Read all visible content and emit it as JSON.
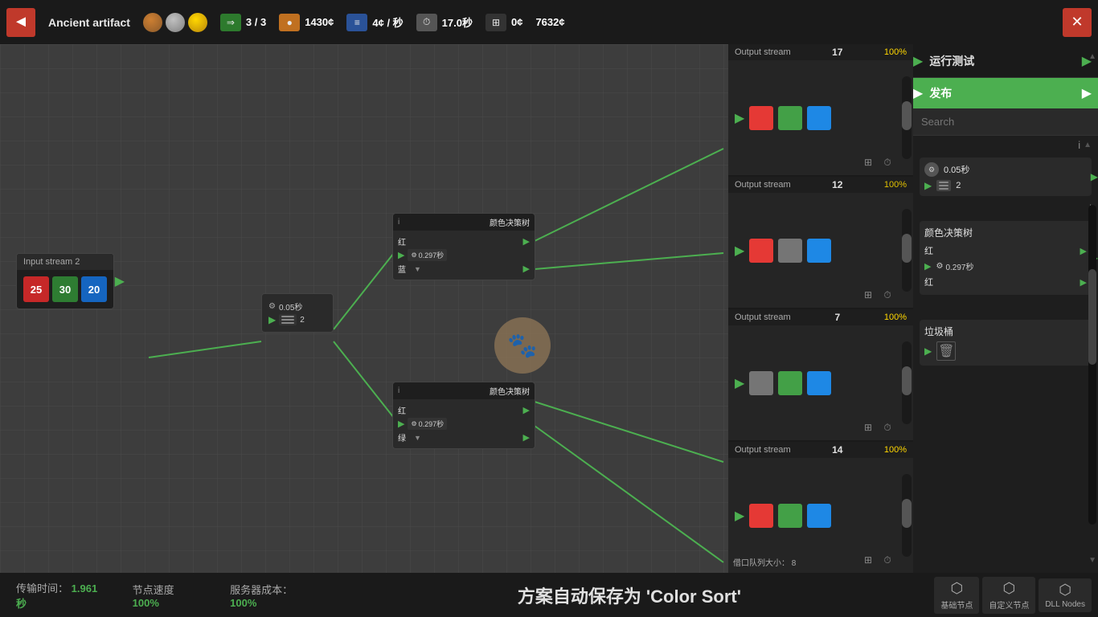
{
  "topbar": {
    "back_label": "◄",
    "title": "Ancient artifact",
    "medals": [
      "bronze",
      "silver",
      "gold"
    ],
    "stat_arrows": "3 / 3",
    "stat_coins": "1430",
    "coin_symbol": "¢",
    "stat_rate": "4¢ / 秒",
    "stat_time": "17.0秒",
    "stat_nodes": "0¢",
    "stat_score": "7632¢",
    "exit_label": "✕"
  },
  "sidebar": {
    "run_label": "运行测试",
    "publish_label": "发布",
    "search_placeholder": "Search",
    "info_icon": "i",
    "scroll_up": "▲",
    "scroll_dn": "▼",
    "node1": {
      "speed": "0.05秒",
      "list_val": "2"
    },
    "node2": {
      "title": "颜色决策树",
      "info": "i",
      "row1_label": "红",
      "speed": "0.297秒",
      "row2_label": "红"
    },
    "node3": {
      "title": "垃圾桶"
    }
  },
  "canvas": {
    "input_node": {
      "title": "Input stream 2",
      "val1": "25",
      "val2": "30",
      "val3": "20"
    },
    "inter_node": {
      "speed": "0.05秒",
      "list": "2"
    },
    "color_node_top": {
      "title": "颜色决策树",
      "row1": "红",
      "speed": "0.297秒",
      "row2": "蓝"
    },
    "color_node_bottom": {
      "title": "颜色决策树",
      "row1": "红",
      "speed": "0.297秒",
      "row2": "绿"
    },
    "output1": {
      "title": "Output stream",
      "count": "17",
      "pct": "100%"
    },
    "output2": {
      "title": "Output stream",
      "count": "12",
      "pct": "100%"
    },
    "output3": {
      "title": "Output stream",
      "count": "7",
      "pct": "100%"
    },
    "output4": {
      "title": "Output stream",
      "count": "14",
      "pct": "100%"
    }
  },
  "status": {
    "transfer_label": "传输时间：",
    "transfer_val": "1.961秒",
    "speed_label": "节点速度",
    "speed_val": "100%",
    "cost_label": "服务器成本：",
    "cost_val": "100%",
    "queue_label": "借口队列大小：",
    "queue_val": "8",
    "autosave": "方案自动保存为 'Color Sort'",
    "btn1": "基础节点",
    "btn2": "自定义节点",
    "btn3": "DLL\nNodes"
  }
}
